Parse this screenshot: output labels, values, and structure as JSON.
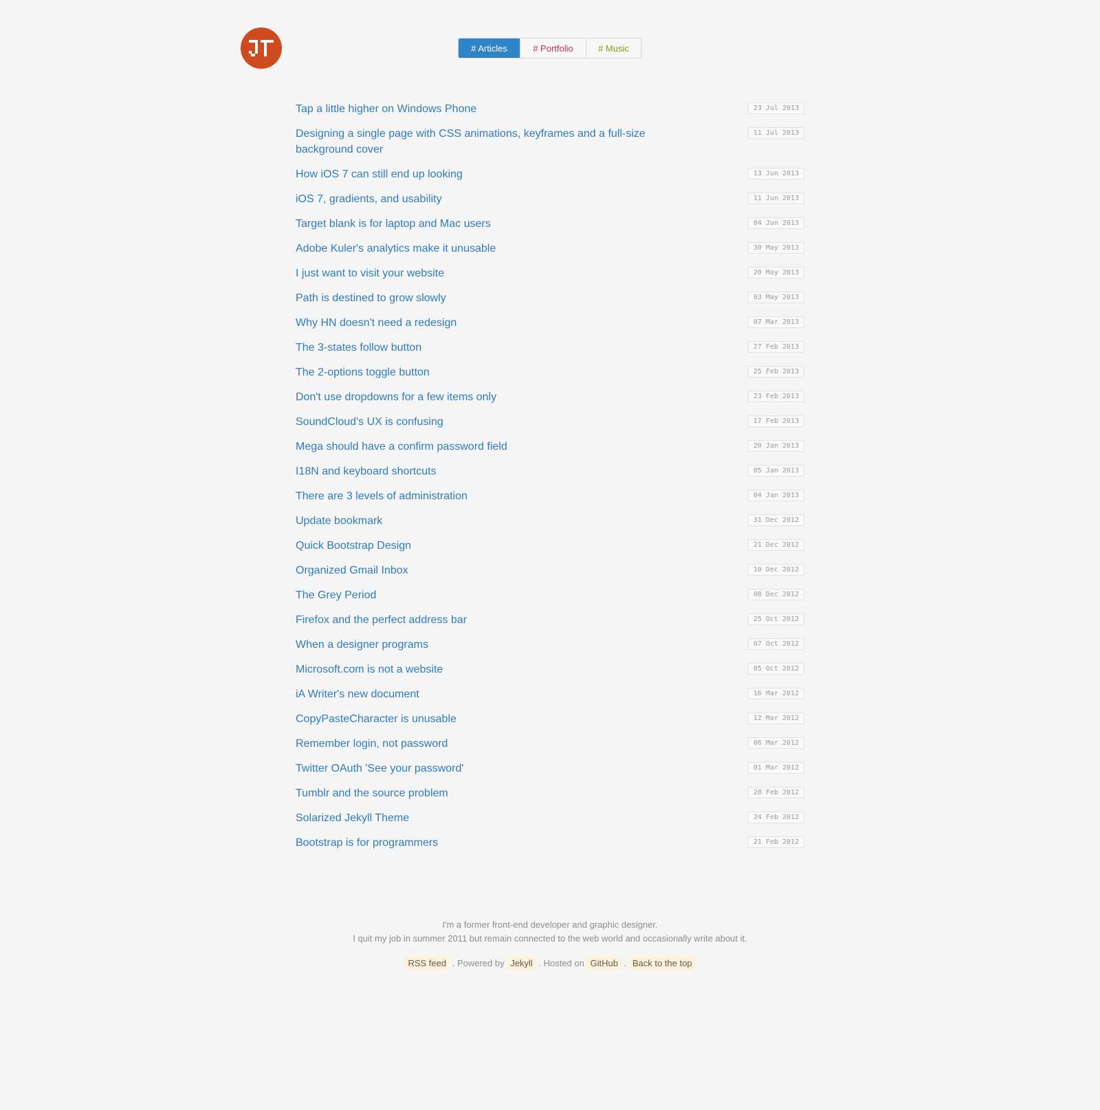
{
  "nav": {
    "tabs": [
      {
        "label": "# Articles"
      },
      {
        "label": "# Portfolio"
      },
      {
        "label": "# Music"
      }
    ]
  },
  "articles": [
    {
      "title": "Tap a little higher on Windows Phone",
      "date": "23 Jul 2013"
    },
    {
      "title": "Designing a single page with CSS animations, keyframes and a full-size background cover",
      "date": "11 Jul 2013"
    },
    {
      "title": "How iOS 7 can still end up looking",
      "date": "13 Jun 2013"
    },
    {
      "title": "iOS 7, gradients, and usability",
      "date": "11 Jun 2013"
    },
    {
      "title": "Target blank is for laptop and Mac users",
      "date": "04 Jun 2013"
    },
    {
      "title": "Adobe Kuler's analytics make it unusable",
      "date": "30 May 2013"
    },
    {
      "title": "I just want to visit your website",
      "date": "20 May 2013"
    },
    {
      "title": "Path is destined to grow slowly",
      "date": "03 May 2013"
    },
    {
      "title": "Why HN doesn't need a redesign",
      "date": "07 Mar 2013"
    },
    {
      "title": "The 3-states follow button",
      "date": "27 Feb 2013"
    },
    {
      "title": "The 2-options toggle button",
      "date": "25 Feb 2013"
    },
    {
      "title": "Don't use dropdowns for a few items only",
      "date": "23 Feb 2013"
    },
    {
      "title": "SoundCloud's UX is confusing",
      "date": "17 Feb 2013"
    },
    {
      "title": "Mega should have a confirm password field",
      "date": "20 Jan 2013"
    },
    {
      "title": "I18N and keyboard shortcuts",
      "date": "05 Jan 2013"
    },
    {
      "title": "There are 3 levels of administration",
      "date": "04 Jan 2013"
    },
    {
      "title": "Update bookmark",
      "date": "31 Dec 2012"
    },
    {
      "title": "Quick Bootstrap Design",
      "date": "21 Dec 2012"
    },
    {
      "title": "Organized Gmail Inbox",
      "date": "10 Dec 2012"
    },
    {
      "title": "The Grey Period",
      "date": "08 Dec 2012"
    },
    {
      "title": "Firefox and the perfect address bar",
      "date": "25 Oct 2012"
    },
    {
      "title": "When a designer programs",
      "date": "07 Oct 2012"
    },
    {
      "title": "Microsoft.com is not a website",
      "date": "05 Oct 2012"
    },
    {
      "title": "iA Writer's new document",
      "date": "16 Mar 2012"
    },
    {
      "title": "CopyPasteCharacter is unusable",
      "date": "12 Mar 2012"
    },
    {
      "title": "Remember login, not password",
      "date": "06 Mar 2012"
    },
    {
      "title": "Twitter OAuth 'See your password'",
      "date": "01 Mar 2012"
    },
    {
      "title": "Tumblr and the source problem",
      "date": "28 Feb 2012"
    },
    {
      "title": "Solarized Jekyll Theme",
      "date": "24 Feb 2012"
    },
    {
      "title": "Bootstrap is for programmers",
      "date": "21 Feb 2012"
    }
  ],
  "footer": {
    "line1": "I'm a former front-end developer and graphic designer.",
    "line2": "I quit my job in summer 2011 but remain connected to the web world and occasionally write about it.",
    "links": {
      "rss": "RSS feed",
      "sep1": ". Powered by",
      "jekyll": "Jekyll",
      "sep2": ". Hosted on",
      "github": "GitHub",
      "sep3": ".",
      "top": "Back to the top"
    }
  },
  "colors": {
    "background": "#f5f5f5",
    "logo": "#cd4b1f",
    "active_tab": "#2e84c6",
    "portfolio_tab": "#c2305e",
    "music_tab": "#8b9a1b",
    "link": "#2f7cbd"
  }
}
